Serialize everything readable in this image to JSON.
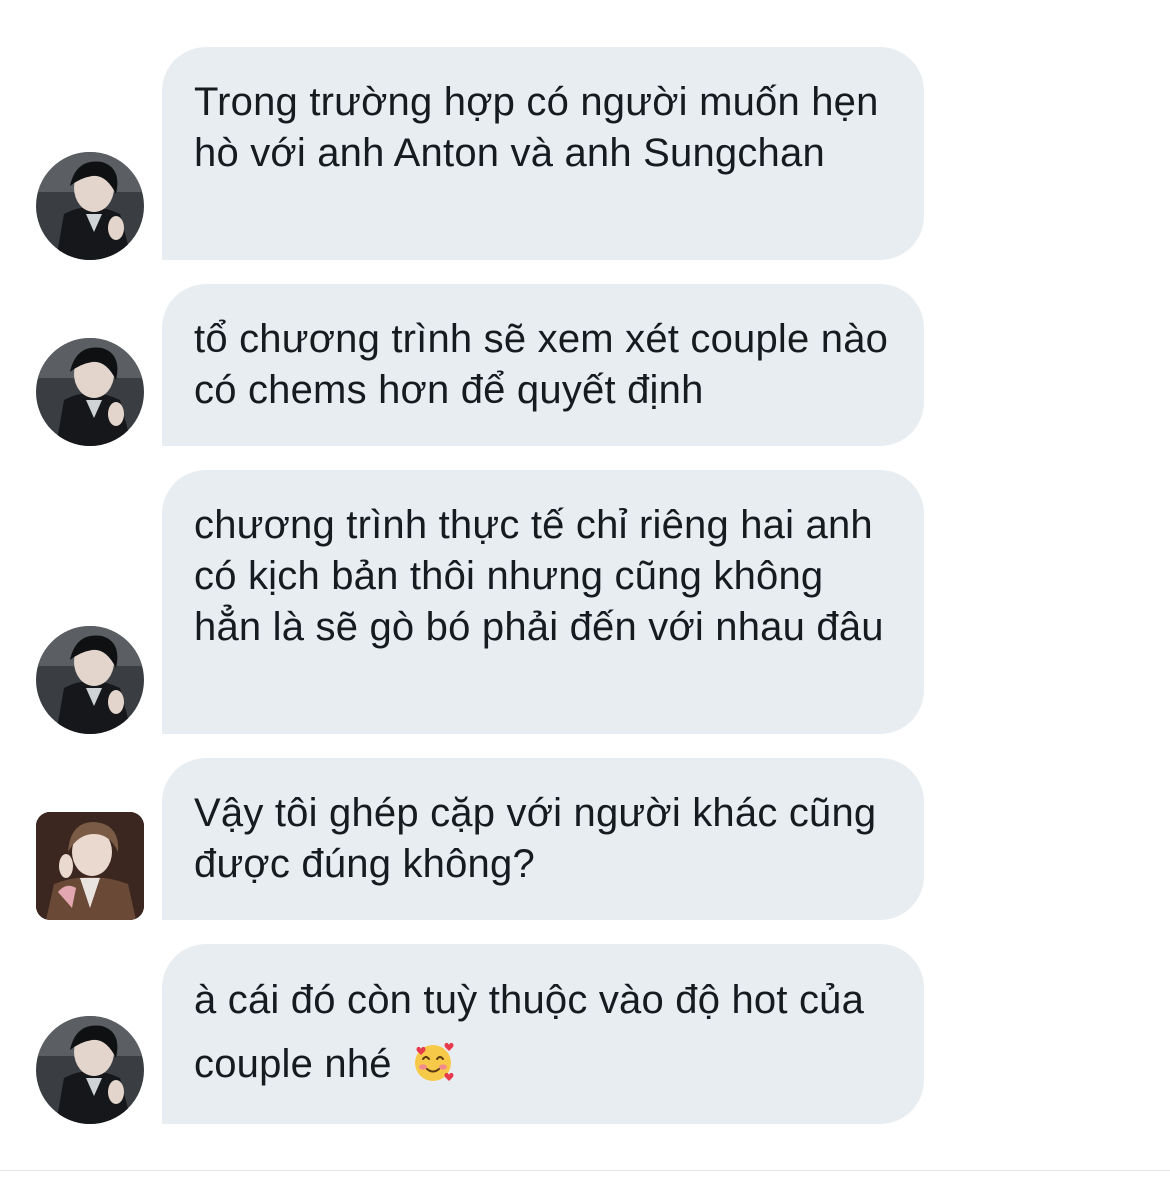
{
  "messages": [
    {
      "text": "Trong trường hợp có người muốn hẹn hò với anh Anton và anh Sungchan",
      "avatar": "user-a-avatar"
    },
    {
      "text": "tổ chương trình sẽ xem xét couple nào có chems hơn để quyết định",
      "avatar": "user-a-avatar"
    },
    {
      "text": "chương trình thực tế chỉ riêng hai anh có kịch bản thôi nhưng cũng không hẳn là sẽ gò bó phải đến với nhau đâu",
      "avatar": "user-a-avatar"
    },
    {
      "text": "Vậy tôi ghép cặp với người khác cũng được đúng không?",
      "avatar": "user-b-avatar"
    },
    {
      "text": "à cái đó còn tuỳ thuộc vào độ hot của couple nhé",
      "avatar": "user-a-avatar",
      "emoji": "smiling-face-with-hearts-icon"
    }
  ],
  "colors": {
    "bubble_bg": "#e8edf2",
    "text": "#161b20",
    "background": "#ffffff"
  }
}
